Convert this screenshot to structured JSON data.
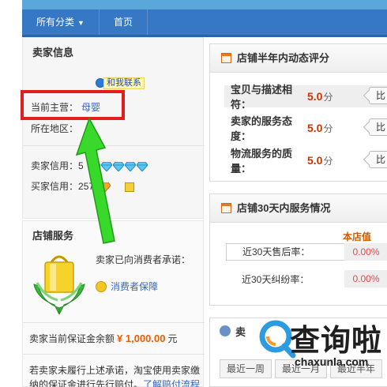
{
  "nav": {
    "all_categories": "所有分类",
    "home": "首页"
  },
  "seller_info": {
    "title": "卖家信息",
    "contact_label": "和我联系",
    "main_business_label": "当前主营：",
    "main_business_value": "母婴",
    "location_label": "所在地区：",
    "location_value": "",
    "seller_credit_label": "卖家信用：",
    "seller_credit_value": "5",
    "seller_credit_diamonds": 5,
    "buyer_credit_label": "买家信用：",
    "buyer_credit_value": "257"
  },
  "shop_service": {
    "title": "店铺服务",
    "promise_text": "卖家已向消费者承诺：",
    "guarantee_label": "消费者保障",
    "deposit_label": "卖家当前保证金余额",
    "deposit_amount": "¥ 1,000.00",
    "deposit_unit": "元",
    "note_line1": "若卖家未履行上述承诺，淘宝使用卖家缴",
    "note_line2": "纳的保证金进行先行赔付。",
    "note_link": "了解赔付流程"
  },
  "ratings": {
    "title": "店铺半年内动态评分",
    "rows": [
      {
        "label": "宝贝与描述相符：",
        "score": "5.0",
        "unit": "分",
        "compare": "比"
      },
      {
        "label": "卖家的服务态度：",
        "score": "5.0",
        "unit": "分",
        "compare": "比"
      },
      {
        "label": "物流服务的质量：",
        "score": "5.0",
        "unit": "分",
        "compare": "比"
      }
    ]
  },
  "service30": {
    "title": "店铺30天内服务情况",
    "column_head": "本店值",
    "rows": [
      {
        "label": "近30天售后率：",
        "value": "0.00%"
      },
      {
        "label": "近30天纠纷率：",
        "value": "0.00%"
      }
    ]
  },
  "third_panel": {
    "title_fragment": "卖",
    "tabs": [
      "最近一周",
      "最近一月",
      "最近半年"
    ]
  },
  "watermark": {
    "text": "查询啦",
    "url": "chaxunla.com"
  },
  "colors": {
    "nav_bg": "#3778c4",
    "highlight_border": "#e41c1c",
    "arrow": "#35d62b",
    "score": "#cc3300",
    "link": "#3566b8"
  }
}
